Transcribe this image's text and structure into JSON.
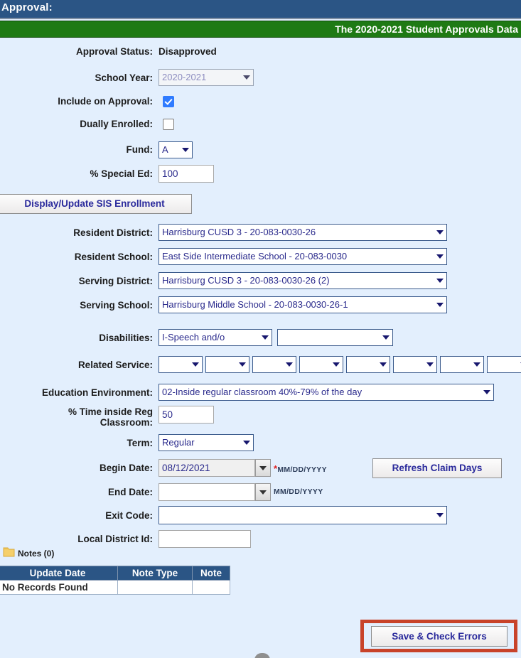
{
  "header": {
    "title": "Approval:",
    "banner": "The 2020-2021 Student Approvals Data"
  },
  "form": {
    "approval_status": {
      "label": "Approval Status:",
      "value": "Disapproved"
    },
    "school_year": {
      "label": "School Year:",
      "value": "2020-2021",
      "disabled": true
    },
    "include_on_approval": {
      "label": "Include on Approval:",
      "checked": true
    },
    "dually_enrolled": {
      "label": "Dually Enrolled:",
      "checked": false
    },
    "fund": {
      "label": "Fund:",
      "value": "A"
    },
    "pct_special_ed": {
      "label": "% Special Ed:",
      "value": "100"
    },
    "sis_button": "Display/Update SIS Enrollment",
    "resident_district": {
      "label": "Resident District:",
      "value": "Harrisburg CUSD 3 - 20-083-0030-26"
    },
    "resident_school": {
      "label": "Resident School:",
      "value": "East Side Intermediate School - 20-083-0030"
    },
    "serving_district": {
      "label": "Serving District:",
      "value": "Harrisburg CUSD 3 - 20-083-0030-26 (2)"
    },
    "serving_school": {
      "label": "Serving School:",
      "value": "Harrisburg Middle School - 20-083-0030-26-1"
    },
    "disabilities": {
      "label": "Disabilities:",
      "value_1": "I-Speech and/o",
      "value_2": ""
    },
    "related_service": {
      "label": "Related Service:",
      "values": [
        "",
        "",
        "",
        "",
        "",
        "",
        "",
        ""
      ]
    },
    "education_environment": {
      "label": "Education Environment:",
      "value": "02-Inside regular classroom 40%-79% of the day"
    },
    "pct_time_inside": {
      "label": "% Time inside Reg Classroom:",
      "value": "50"
    },
    "term": {
      "label": "Term:",
      "value": "Regular"
    },
    "begin_date": {
      "label": "Begin Date:",
      "value": "08/12/2021",
      "required_mark": "*",
      "format": "MM/DD/YYYY"
    },
    "end_date": {
      "label": "End Date:",
      "value": "",
      "format": "MM/DD/YYYY"
    },
    "refresh_button": "Refresh Claim Days",
    "exit_code": {
      "label": "Exit Code:",
      "value": ""
    },
    "local_district_id": {
      "label": "Local District Id:",
      "value": ""
    }
  },
  "notes": {
    "section_label": "Notes (0)",
    "columns": [
      "Update Date",
      "Note Type",
      "Note"
    ],
    "empty_text": "No Records Found"
  },
  "actions": {
    "save_label": "Save & Check Errors"
  },
  "colors": {
    "title_bar": "#2b5585",
    "banner_bar": "#1e7a14",
    "page_bg": "#e3effd",
    "annotation": "#c8432a",
    "link_text": "#2a2a9c"
  }
}
